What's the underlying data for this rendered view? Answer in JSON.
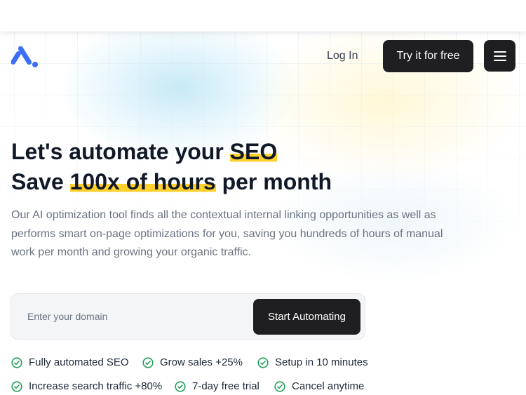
{
  "nav": {
    "logo": "brand-logo",
    "login_label": "Log In",
    "try_label": "Try it for free",
    "menu_icon": "hamburger-icon"
  },
  "hero": {
    "line1_text": "Let's automate your ",
    "line1_highlight": "SEO",
    "line2_text": "Save ",
    "line2_highlight": "100x of hours",
    "line2_suffix": " per month",
    "description": "Our AI optimization tool finds all the contextual internal linking opportunities as well as performs smart on-page optimizations for you, saving you hundreds of hours of manual work per month and growing your organic traffic."
  },
  "form": {
    "domain_placeholder": "Enter your domain",
    "domain_value": "",
    "submit_label": "Start Automating"
  },
  "features": [
    "Fully automated SEO",
    "Grow sales +25%",
    "Setup in 10 minutes",
    "Increase search traffic +80%",
    "7-day free trial",
    "Cancel anytime"
  ],
  "colors": {
    "accent_dark": "#1f1f21",
    "highlight": "#ffd12e",
    "check_green": "#22a05a",
    "logo_blue": "#3b6ff5"
  }
}
